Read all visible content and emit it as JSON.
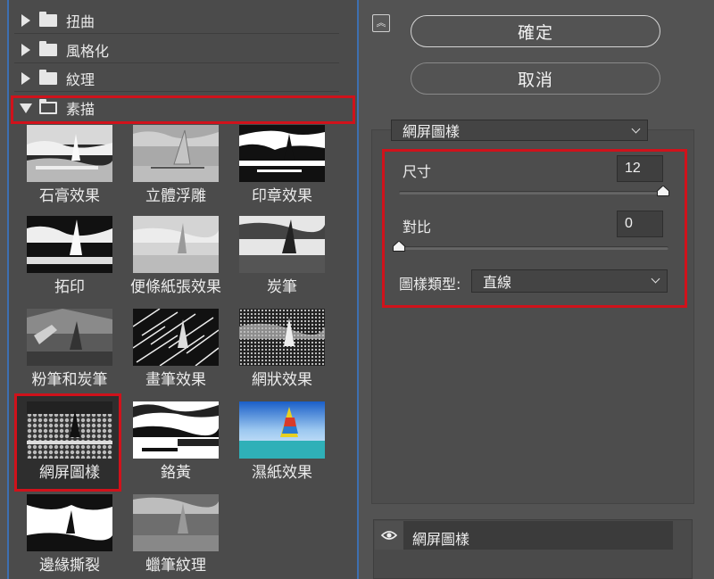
{
  "gallery": {
    "categories": [
      {
        "label": "扭曲",
        "expanded": false
      },
      {
        "label": "風格化",
        "expanded": false
      },
      {
        "label": "紋理",
        "expanded": false
      },
      {
        "label": "素描",
        "expanded": true
      }
    ],
    "filters": [
      {
        "label": "石膏效果"
      },
      {
        "label": "立體浮雕"
      },
      {
        "label": "印章效果"
      },
      {
        "label": "拓印"
      },
      {
        "label": "便條紙張效果"
      },
      {
        "label": "炭筆"
      },
      {
        "label": "粉筆和炭筆"
      },
      {
        "label": "畫筆效果"
      },
      {
        "label": "網狀效果"
      },
      {
        "label": "網屏圖樣"
      },
      {
        "label": "鉻黃"
      },
      {
        "label": "濕紙效果"
      },
      {
        "label": "邊緣撕裂"
      },
      {
        "label": "蠟筆紋理"
      }
    ],
    "selected_filter": "網屏圖樣"
  },
  "buttons": {
    "ok_label": "確定",
    "cancel_label": "取消",
    "collapse_icon": "double-chevron-up-icon"
  },
  "settings": {
    "filter_dropdown_value": "網屏圖樣",
    "size_label": "尺寸",
    "size_value": "12",
    "size_slider_fraction": 0.98,
    "contrast_label": "對比",
    "contrast_value": "0",
    "contrast_slider_fraction": 0.0,
    "pattern_type_label": "圖樣類型:",
    "pattern_type_value": "直線"
  },
  "layers": {
    "name": "網屏圖樣",
    "visibility_icon": "eye-icon"
  },
  "colors": {
    "highlight_red": "#d0121b",
    "panel_bg": "#535353",
    "gallery_border": "#3d6fb0"
  }
}
